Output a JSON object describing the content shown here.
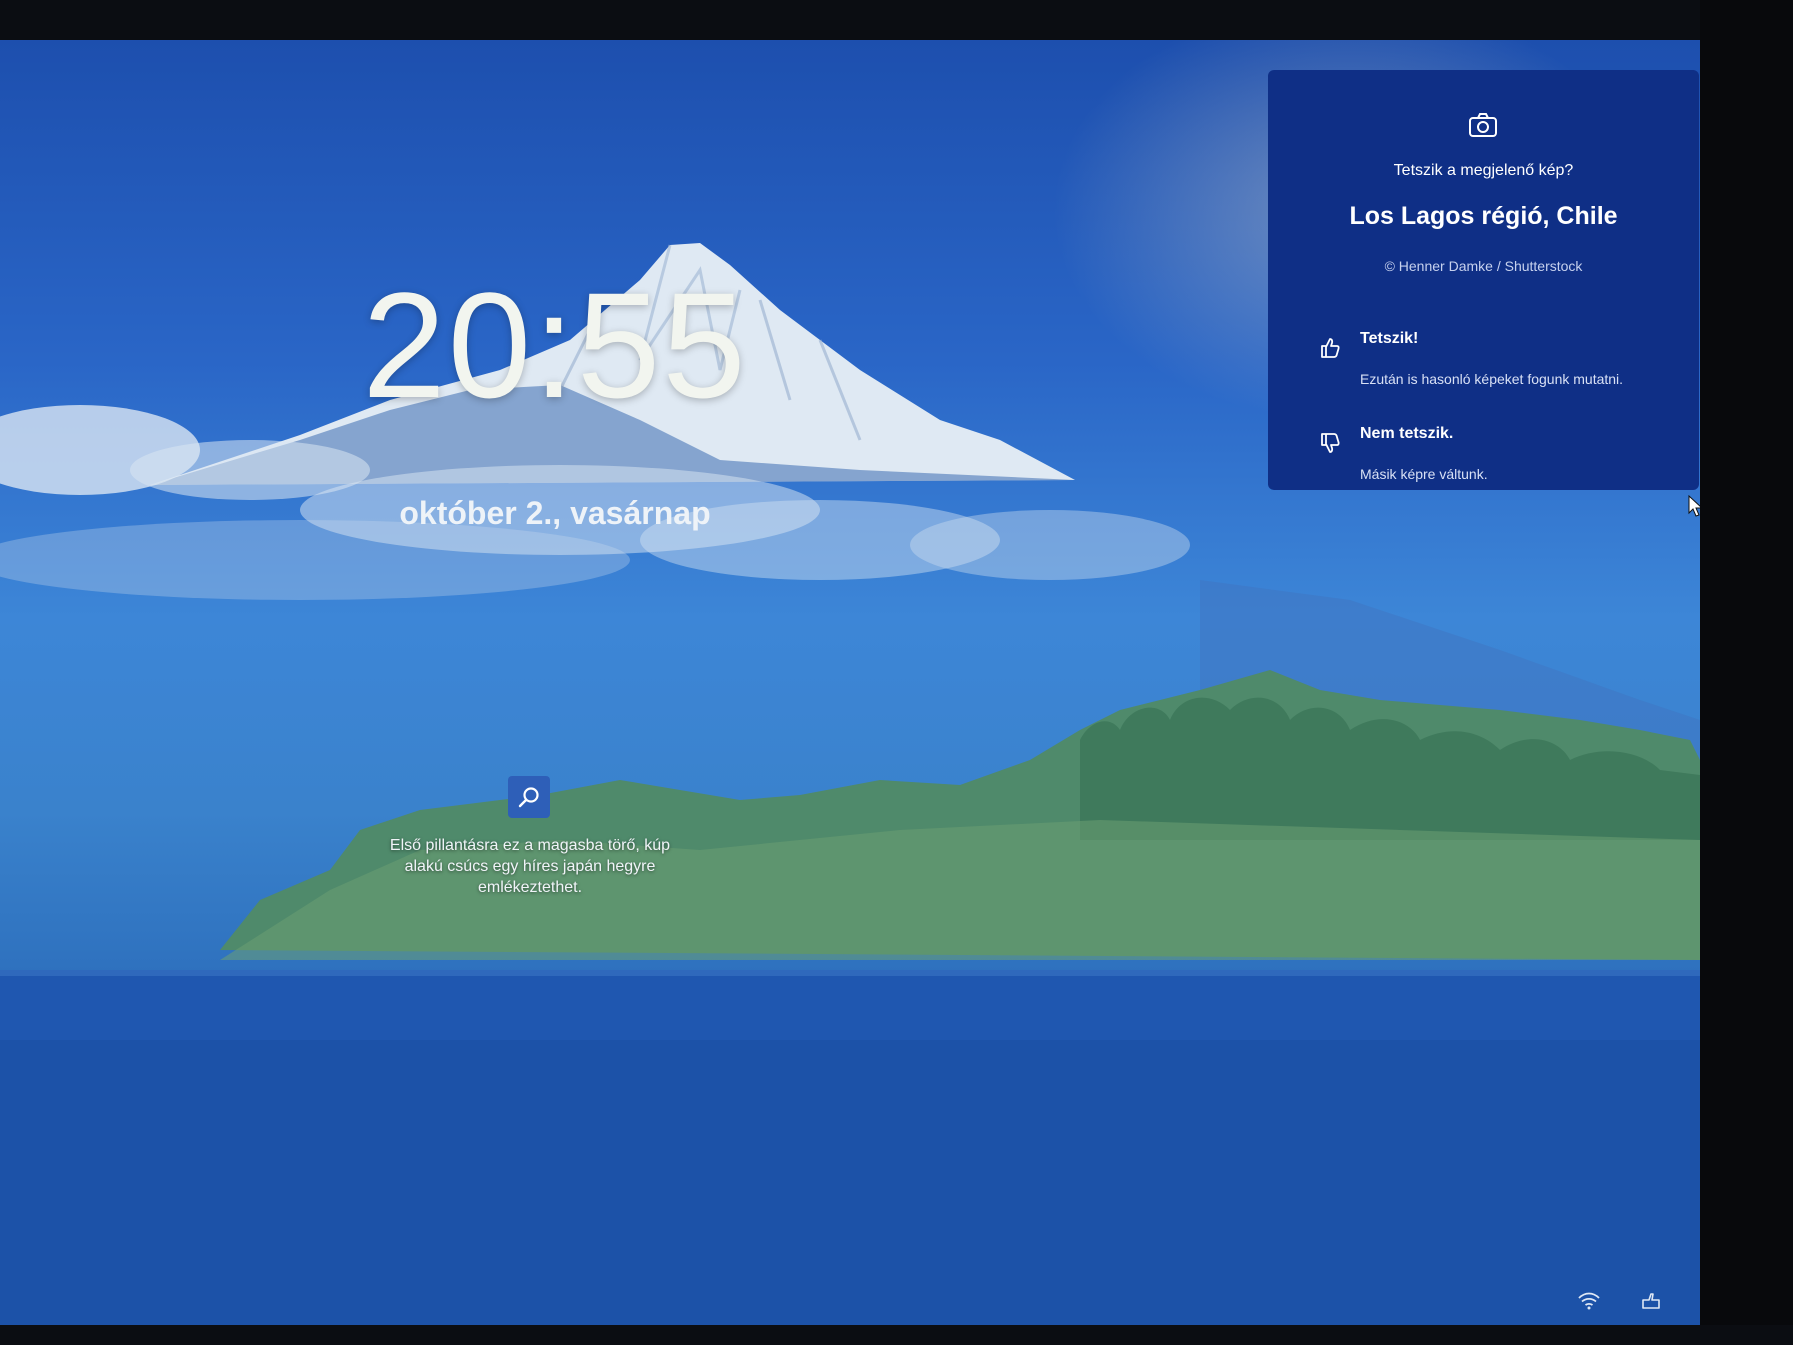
{
  "lockscreen": {
    "time": "20:55",
    "date": "október 2., vasárnap",
    "fact": {
      "icon": "search-icon",
      "text": "Első pillantásra ez a magasba törő, kúp alakú csúcs egy híres japán hegyre emlékeztethet."
    }
  },
  "spotlight_panel": {
    "icon": "camera-icon",
    "question": "Tetszik a megjelenő kép?",
    "location": "Los Lagos régió, Chile",
    "credit": "© Henner Damke / Shutterstock",
    "like": {
      "icon": "thumbs-up-icon",
      "label": "Tetszik!",
      "description": "Ezután is hasonló képeket fogunk mutatni."
    },
    "dislike": {
      "icon": "thumbs-down-icon",
      "label": "Nem tetszik.",
      "description": "Másik képre váltunk."
    }
  },
  "system_tray": {
    "icons": [
      "wifi-icon",
      "accessibility-icon"
    ]
  },
  "colors": {
    "panel_background": "#0f2f86",
    "sky": "#2a66c7",
    "water": "#1e4fa6"
  }
}
